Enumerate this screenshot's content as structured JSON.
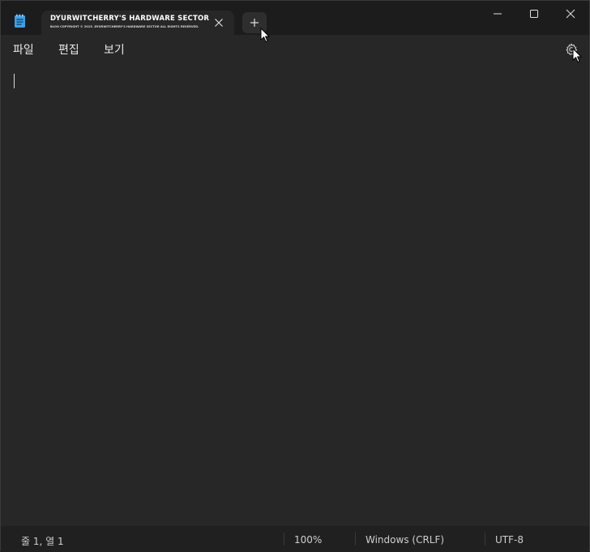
{
  "tab": {
    "title": "DYURWITCHERRY'S HARDWARE SECTOR",
    "subtitle": "BLOG COPYRIGHT © 2015. DYURWITCHERRY'S HARDWARE SECTOR ALL RIGHTS RESERVED."
  },
  "menu": {
    "file": "파일",
    "edit": "편집",
    "view": "보기"
  },
  "status": {
    "position": "줄 1, 열 1",
    "zoom": "100%",
    "line_ending": "Windows (CRLF)",
    "encoding": "UTF-8"
  },
  "icons": {
    "app": "notepad-icon",
    "tab_close": "close-icon",
    "new_tab": "plus-icon",
    "settings": "gear-icon",
    "minimize": "minimize-icon",
    "maximize": "maximize-icon",
    "close": "close-icon"
  },
  "colors": {
    "background": "#272727",
    "titlebar": "#1c1c1c",
    "statusbar": "#202020",
    "app_icon": "#3aa0e6"
  }
}
